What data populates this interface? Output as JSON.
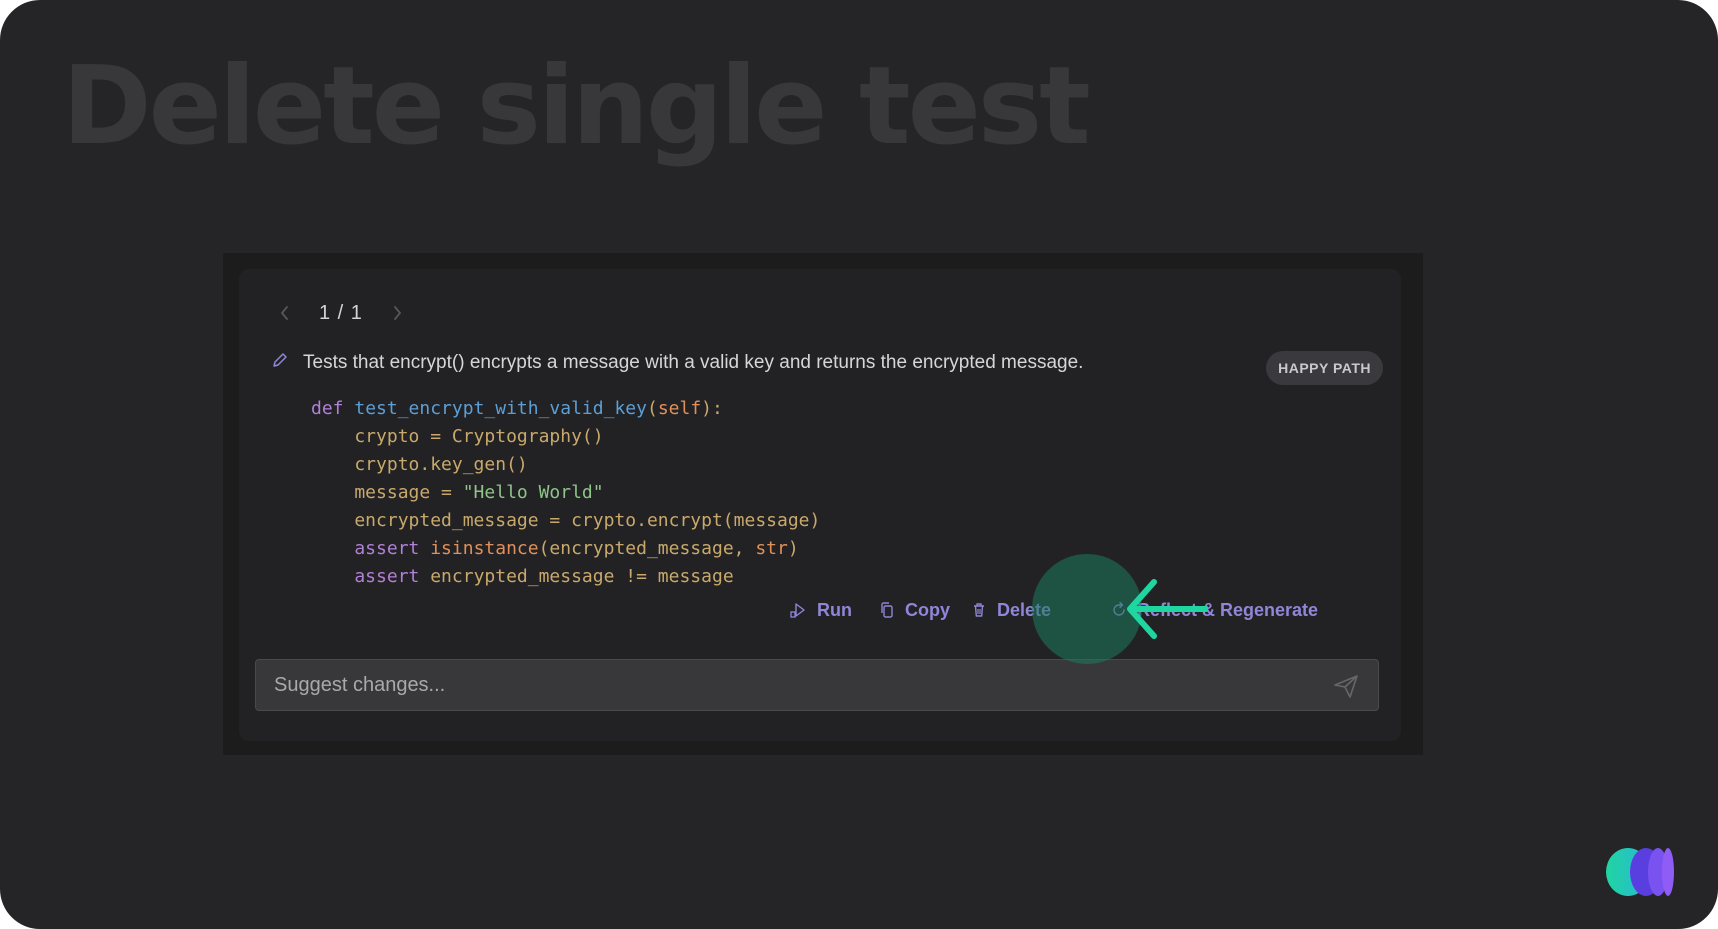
{
  "slide": {
    "title": "Delete single test"
  },
  "pager": {
    "prev_icon": "chevron-left-icon",
    "next_icon": "chevron-right-icon",
    "count": "1 / 1"
  },
  "test": {
    "edit_icon": "pencil-icon",
    "description": "Tests that encrypt() encrypts a message with a valid key and returns the encrypted message.",
    "badge": "HAPPY PATH",
    "code_lines": [
      "def test_encrypt_with_valid_key(self):",
      "    crypto = Cryptography()",
      "    crypto.key_gen()",
      "    message = \"Hello World\"",
      "    encrypted_message = crypto.encrypt(message)",
      "    assert isinstance(encrypted_message, str)",
      "    assert encrypted_message != message"
    ]
  },
  "actions": {
    "run": "Run",
    "copy": "Copy",
    "delete": "Delete",
    "regenerate": "Reflect & Regenerate"
  },
  "suggest": {
    "placeholder": "Suggest changes...",
    "send_icon": "send-icon"
  },
  "colors": {
    "background": "#252527",
    "accent": "#8f86d8",
    "highlight": "#1c7a5c",
    "arrow": "#1fd6a0"
  }
}
